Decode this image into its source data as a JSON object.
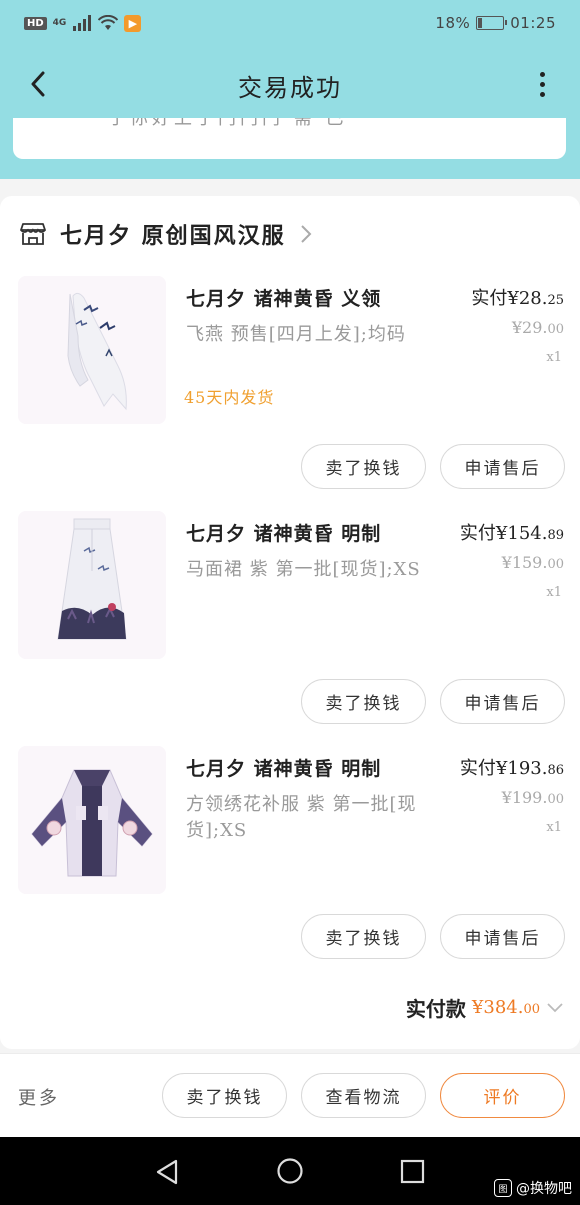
{
  "status_bar": {
    "hd": "HD",
    "network": "4G",
    "battery_text": "18%",
    "battery_level": 0.18,
    "time": "01:25"
  },
  "nav": {
    "title": "交易成功"
  },
  "top_card": {
    "partial_text": "于你好上于门门门 需 已"
  },
  "shop": {
    "name": "七月夕 原创国风汉服"
  },
  "items": [
    {
      "title": "七月夕 诸神黄昏 义领",
      "spec": "飞燕 预售[四月上发];均码",
      "ship": "45天内发货",
      "paid_label": "实付",
      "paid_main": "¥28.",
      "paid_dec": "25",
      "orig_main": "¥29.",
      "orig_dec": "00",
      "qty": "x1"
    },
    {
      "title": "七月夕 诸神黄昏 明制",
      "spec": "马面裙 紫 第一批[现货];XS",
      "ship": "",
      "paid_label": "实付",
      "paid_main": "¥154.",
      "paid_dec": "89",
      "orig_main": "¥159.",
      "orig_dec": "00",
      "qty": "x1"
    },
    {
      "title": "七月夕 诸神黄昏 明制",
      "spec": "方领绣花补服 紫 第一批[现货];XS",
      "ship": "",
      "paid_label": "实付",
      "paid_main": "¥193.",
      "paid_dec": "86",
      "orig_main": "¥199.",
      "orig_dec": "00",
      "qty": "x1"
    }
  ],
  "item_buttons": {
    "sell": "卖了换钱",
    "after_sale": "申请售后"
  },
  "total": {
    "label": "实付款",
    "value_main": "¥384.",
    "value_dec": "00"
  },
  "bottom_bar": {
    "more": "更多",
    "sell": "卖了换钱",
    "logistics": "查看物流",
    "review": "评价"
  },
  "watermark": {
    "logo": "图",
    "text": "@换物吧"
  },
  "colors": {
    "header_teal": "#94dde3",
    "accent_orange": "#ee7a24",
    "ship_orange": "#f0a030"
  }
}
